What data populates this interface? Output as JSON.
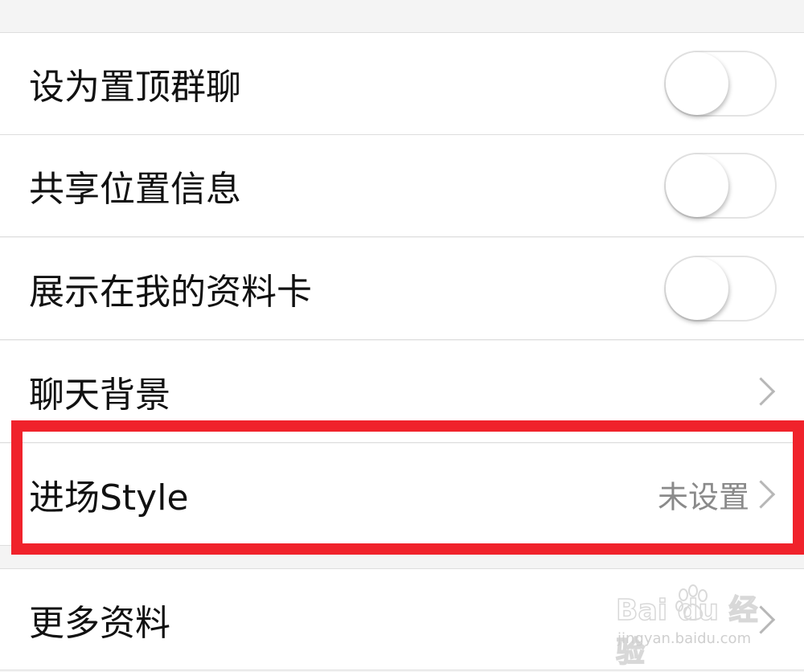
{
  "settings": {
    "rows": [
      {
        "label": "设为置顶群聊",
        "control": "toggle",
        "on": false
      },
      {
        "label": "共享位置信息",
        "control": "toggle",
        "on": false
      },
      {
        "label": "展示在我的资料卡",
        "control": "toggle",
        "on": false
      },
      {
        "label": "聊天背景",
        "control": "chevron"
      },
      {
        "label": "进场Style",
        "control": "chevron",
        "value": "未设置"
      },
      {
        "label": "更多资料",
        "control": "chevron"
      }
    ]
  },
  "annotation": {
    "highlight_color": "#f0222b",
    "highlighted_row": "进场Style"
  },
  "watermark": {
    "logo_text": "Bai du 经验",
    "url": "jingyan.baidu.com"
  },
  "colors": {
    "background": "#f4f4f4",
    "row_background": "#ffffff",
    "divider": "#dedede",
    "label_text": "#111111",
    "secondary_text": "#8a8a8a",
    "chevron": "#b7b7b7"
  }
}
